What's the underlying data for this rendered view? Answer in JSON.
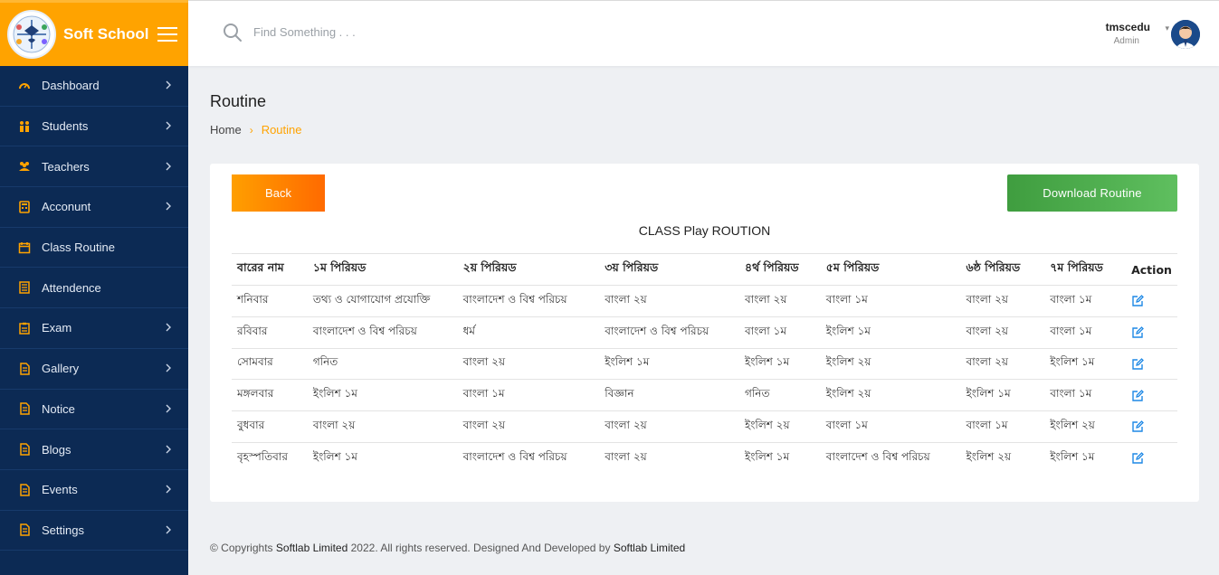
{
  "brand": {
    "name": "Soft School"
  },
  "sidebar": {
    "items": [
      {
        "label": "Dashboard",
        "icon": "gauge-icon",
        "has_arrow": true
      },
      {
        "label": "Students",
        "icon": "students-icon",
        "has_arrow": true
      },
      {
        "label": "Teachers",
        "icon": "teachers-icon",
        "has_arrow": true
      },
      {
        "label": "Acconunt",
        "icon": "calculator-icon",
        "has_arrow": true
      },
      {
        "label": "Class Routine",
        "icon": "calendar-icon",
        "has_arrow": false
      },
      {
        "label": "Attendence",
        "icon": "list-icon",
        "has_arrow": false
      },
      {
        "label": "Exam",
        "icon": "clipboard-icon",
        "has_arrow": true
      },
      {
        "label": "Gallery",
        "icon": "document-icon",
        "has_arrow": true
      },
      {
        "label": "Notice",
        "icon": "document-icon",
        "has_arrow": true
      },
      {
        "label": "Blogs",
        "icon": "document-icon",
        "has_arrow": true
      },
      {
        "label": "Events",
        "icon": "document-icon",
        "has_arrow": true
      },
      {
        "label": "Settings",
        "icon": "document-icon",
        "has_arrow": true
      }
    ]
  },
  "topbar": {
    "search_placeholder": "Find Something . . .",
    "user_name": "tmscedu",
    "user_role": "Admin",
    "caret": "▾"
  },
  "page": {
    "title": "Routine",
    "breadcrumb_home": "Home",
    "breadcrumb_sep": "›",
    "breadcrumb_current": "Routine"
  },
  "card": {
    "back_label": "Back",
    "download_label": "Download Routine",
    "title": "CLASS Play ROUTION"
  },
  "table": {
    "headers": [
      "বারের নাম",
      "১ম পিরিয়ড",
      "২য় পিরিয়ড",
      "৩য় পিরিয়ড",
      "৪র্থ পিরিয়ড",
      "৫ম পিরিয়ড",
      "৬ষ্ঠ পিরিয়ড",
      "৭ম পিরিয়ড",
      "Action"
    ],
    "rows": [
      [
        "শনিবার",
        "তথ্য ও যোগাযোগ প্রযোক্তি",
        "বাংলাদেশ ও বিশ্ব পরিচয়",
        "বাংলা ২য়",
        "বাংলা ২য়",
        "বাংলা ১ম",
        "বাংলা ২য়",
        "বাংলা ১ম"
      ],
      [
        "রবিবার",
        "বাংলাদেশ ও বিশ্ব পরিচয়",
        "ধর্ম",
        "বাংলাদেশ ও বিশ্ব পরিচয়",
        "বাংলা ১ম",
        "ইংলিশ ১ম",
        "বাংলা ২য়",
        "বাংলা ১ম"
      ],
      [
        "সোমবার",
        "গনিত",
        "বাংলা ২য়",
        "ইংলিশ ১ম",
        "ইংলিশ ১ম",
        "ইংলিশ ২য়",
        "বাংলা ২য়",
        "ইংলিশ ১ম"
      ],
      [
        "মঙ্গলবার",
        "ইংলিশ ১ম",
        "বাংলা ১ম",
        "বিজ্ঞান",
        "গনিত",
        "ইংলিশ ২য়",
        "ইংলিশ ১ম",
        "বাংলা ১ম"
      ],
      [
        "বুধবার",
        "বাংলা ২য়",
        "বাংলা ২য়",
        "বাংলা ২য়",
        "ইংলিশ ২য়",
        "বাংলা ১ম",
        "বাংলা ১ম",
        "ইংলিশ ২য়"
      ],
      [
        "বৃহস্পতিবার",
        "ইংলিশ ১ম",
        "বাংলাদেশ ও বিশ্ব পরিচয়",
        "বাংলা ২য়",
        "ইংলিশ ১ম",
        "বাংলাদেশ ও বিশ্ব পরিচয়",
        "ইংলিশ ২য়",
        "ইংলিশ ১ম"
      ]
    ]
  },
  "footer": {
    "prefix": "© Copyrights",
    "company1": "Softlab Limited",
    "middle": "2022. All rights reserved. Designed And Developed by",
    "company2": "Softlab Limited"
  },
  "colors": {
    "accent": "#ffa300",
    "sidebar_bg": "#0c2a54",
    "download_button": "#4caf50",
    "edit_icon": "#1e88e5"
  }
}
